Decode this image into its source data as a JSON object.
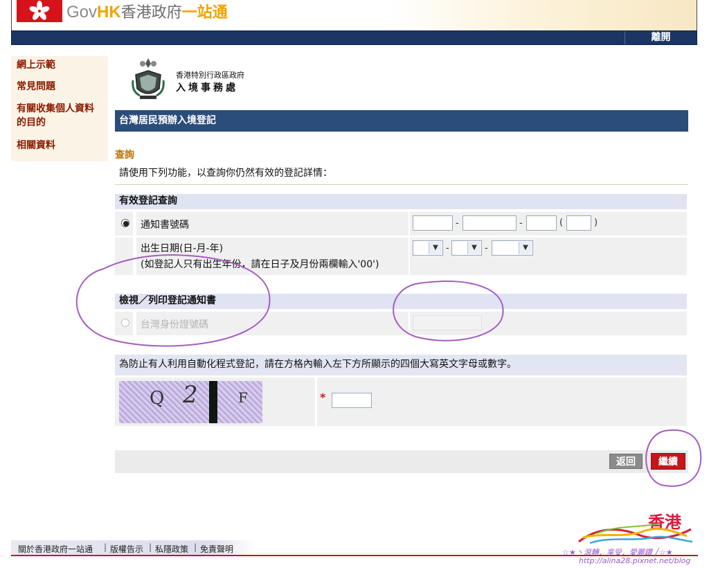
{
  "header": {
    "logo_gov": "Gov",
    "logo_hk": "HK",
    "logo_zh": "香港政府",
    "logo_zh2": "一站通",
    "exit_label": "離開"
  },
  "sidebar": {
    "items": [
      {
        "label": "網上示範"
      },
      {
        "label": "常見問題"
      },
      {
        "label": "有關收集個人資料"
      },
      {
        "label": "的目的"
      },
      {
        "label": "相關資料"
      }
    ]
  },
  "department": {
    "name_line1": "香港特別行政區政府",
    "name_line2": "入境事務處"
  },
  "page_title": "台灣居民預辦入境登記",
  "enquiry": {
    "heading": "查詢",
    "description": "請使用下列功能，以查詢你仍然有效的登記詳情："
  },
  "section1": {
    "heading": "有效登記查詢",
    "notice_label": "通知書號碼",
    "notice_dash1": "-",
    "notice_dash2": "-",
    "notice_paren_open": "(",
    "notice_paren_close": ")",
    "dob_label": "出生日期(日-月-年)",
    "dob_hint": "(如登記人只有出生年份，請在日子及月份兩欄輸入'00')",
    "dob_dash": "-",
    "notice_selected": true
  },
  "section2": {
    "heading": "檢視／列印登記通知書",
    "tw_id_label": "台灣身份證號碼",
    "disabled": true
  },
  "captcha": {
    "instruction": "為防止有人利用自動化程式登記，請在方格內輸入左下方所顯示的四個大寫英文字母或數字。",
    "char1": "Q",
    "char2": "2",
    "char3": "F",
    "required_mark": "*"
  },
  "buttons": {
    "back_label": "返回",
    "continue_label": "繼續"
  },
  "footer": {
    "links": [
      {
        "label": "關於香港政府一站通"
      },
      {
        "label": "版權告示"
      },
      {
        "label": "私隱政策"
      },
      {
        "label": "免責聲明"
      }
    ],
    "separator": "|",
    "brand_hk": "香港",
    "watermark_line1": "☆★丶滾轉．享受．愛麗鑽 ╱☆★",
    "watermark_line2": "http://alina28.pixnet.net/blog"
  },
  "colors": {
    "nav_blue": "#1b3564",
    "title_blue": "#2b4d7a",
    "sidebar_link": "#8a1a00",
    "accent_orange": "#f0a400",
    "continue_red": "#c4161c",
    "annotation_purple": "#a45cc2"
  },
  "icons": {
    "hk_emblem": "bauhinia-flag-icon",
    "dept_emblem": "immigration-crest-icon",
    "select_arrow": "chevron-down-icon"
  }
}
